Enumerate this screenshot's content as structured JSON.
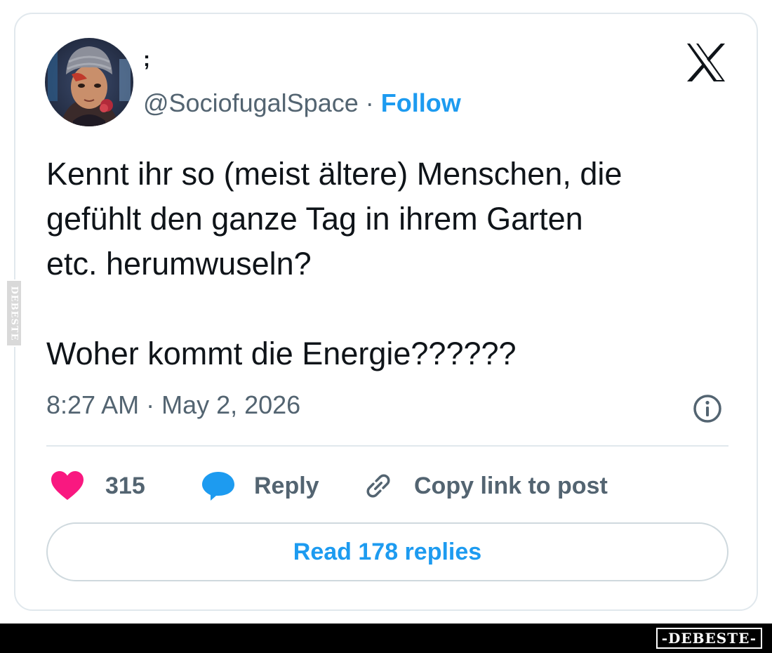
{
  "tweet": {
    "display_name": ";",
    "handle": "@SociofugalSpace",
    "separator": "·",
    "follow_label": "Follow",
    "text": "Kennt ihr so (meist ältere) Menschen, die\ngefühlt den ganze Tag in ihrem Garten\netc. herumwuseln?\n\nWoher kommt die Energie??????",
    "timestamp": "8:27 AM · May 2, 2026"
  },
  "actions": {
    "like_count": "315",
    "reply_label": "Reply",
    "copy_link_label": "Copy link to post"
  },
  "read_replies_label": "Read 178 replies",
  "icons": {
    "brand": "x-logo-icon",
    "info": "info-icon",
    "like": "heart-icon",
    "reply": "speech-bubble-icon",
    "copy": "link-icon"
  },
  "colors": {
    "accent": "#1d9bf0",
    "like": "#f91880",
    "muted": "#536471",
    "text": "#0f1419"
  },
  "watermark": {
    "bottom": "-DEBESTE-",
    "side": "DEBESTE"
  }
}
